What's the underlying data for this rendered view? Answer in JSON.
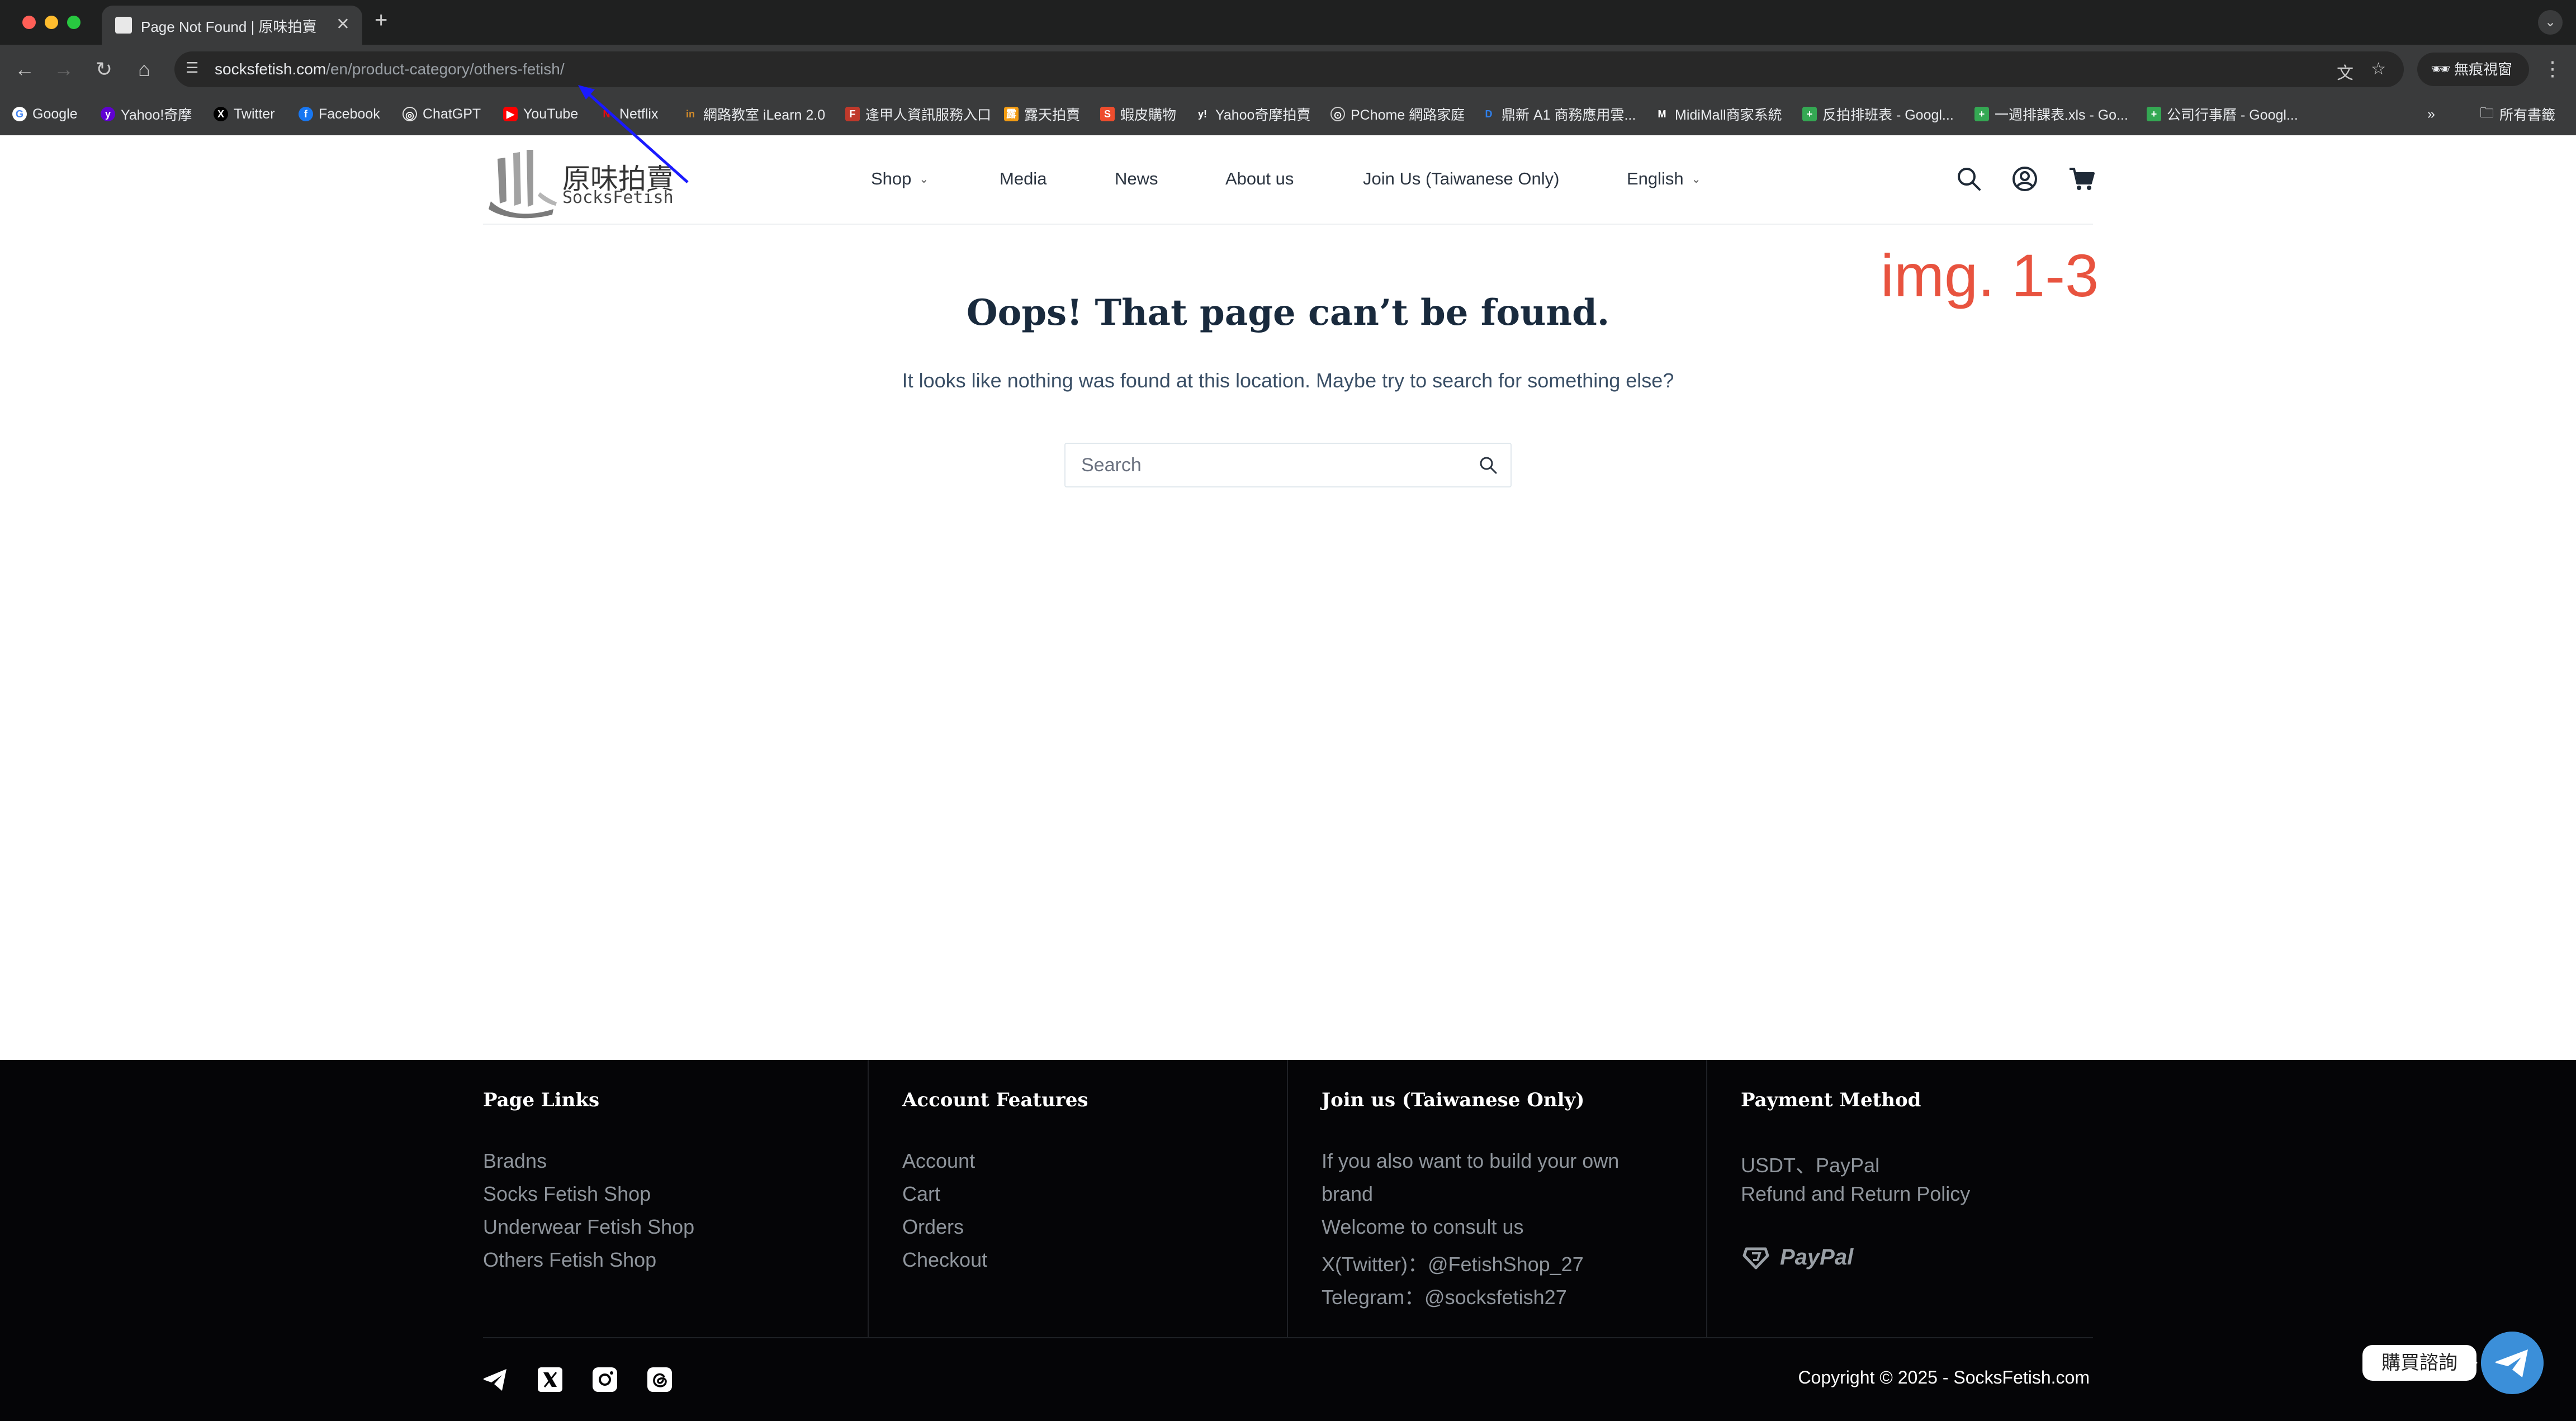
{
  "browser": {
    "tab_title": "Page Not Found | 原味拍賣",
    "url_host": "socksfetish.com",
    "url_path": "/en/product-category/others-fetish/",
    "incognito_label": "無痕視窗",
    "bookmarks": [
      {
        "label": "Google",
        "icon": "google-icon",
        "color": "#ffffff"
      },
      {
        "label": "Yahoo!奇摩",
        "icon": "yahoo-icon",
        "color": "#6001d2"
      },
      {
        "label": "Twitter",
        "icon": "x-icon",
        "color": "#000000"
      },
      {
        "label": "Facebook",
        "icon": "facebook-icon",
        "color": "#1877f2"
      },
      {
        "label": "ChatGPT",
        "icon": "chatgpt-icon",
        "color": "#ffffff"
      },
      {
        "label": "YouTube",
        "icon": "youtube-icon",
        "color": "#ff0000"
      },
      {
        "label": "Netflix",
        "icon": "netflix-icon",
        "color": "#e50914"
      },
      {
        "label": "網路教室 iLearn 2.0",
        "icon": "ilearn-icon",
        "color": "#d08a2a"
      },
      {
        "label": "逢甲人資訊服務入口",
        "icon": "fcu-icon",
        "color": "#c0392b"
      },
      {
        "label": "露天拍賣",
        "icon": "ruten-icon",
        "color": "#f39c12"
      },
      {
        "label": "蝦皮購物",
        "icon": "shopee-icon",
        "color": "#ee4d2d"
      },
      {
        "label": "Yahoo奇摩拍賣",
        "icon": "yahoo-auction-icon",
        "color": "#ffffff"
      },
      {
        "label": "PChome 網路家庭",
        "icon": "pchome-icon",
        "color": "#cccccc"
      },
      {
        "label": "鼎新 A1 商務應用雲...",
        "icon": "digiwin-icon",
        "color": "#2f80ed"
      },
      {
        "label": "MidiMall商家系統",
        "icon": "midimall-icon",
        "color": "#ffffff"
      },
      {
        "label": "反拍排班表 - Googl...",
        "icon": "sheets-icon",
        "color": "#34a853"
      },
      {
        "label": "一週排課表.xls - Go...",
        "icon": "sheets-icon",
        "color": "#34a853"
      },
      {
        "label": "公司行事曆 - Googl...",
        "icon": "sheets-icon",
        "color": "#34a853"
      }
    ],
    "all_bookmarks_label": "所有書籤"
  },
  "header": {
    "logo_cn": "原味拍賣",
    "logo_en": "SocksFetish",
    "nav": [
      {
        "label": "Shop",
        "dropdown": true
      },
      {
        "label": "Media",
        "dropdown": false
      },
      {
        "label": "News",
        "dropdown": false
      },
      {
        "label": "About us",
        "dropdown": false
      },
      {
        "label": "Join Us (Taiwanese Only)",
        "dropdown": false
      },
      {
        "label": "English",
        "dropdown": true
      }
    ]
  },
  "annotation": "img. 1-3",
  "main": {
    "title": "Oops! That page can’t be found.",
    "subtitle": "It looks like nothing was found at this location. Maybe try to search for something else?",
    "search_placeholder": "Search"
  },
  "footer": {
    "columns": [
      {
        "title": "Page Links",
        "links": [
          "Bradns",
          "Socks Fetish Shop",
          "Underwear Fetish Shop",
          "Others Fetish Shop"
        ]
      },
      {
        "title": "Account Features",
        "links": [
          "Account",
          "Cart",
          "Orders",
          "Checkout"
        ]
      },
      {
        "title": "Join us (Taiwanese Only)",
        "links": [
          "If you also want to build your own",
          "brand",
          "Welcome to consult us",
          "X(Twitter)：@FetishShop_27",
          "Telegram：@socksfetish27"
        ]
      },
      {
        "title": "Payment Method",
        "links": [
          "USDT、PayPal",
          "Refund and Return Policy"
        ],
        "paypal_label": "PayPal"
      }
    ],
    "copyright": "Copyright © 2025 - SocksFetish.com",
    "social_icons": [
      "telegram-icon",
      "x-icon",
      "instagram-icon",
      "threads-icon"
    ]
  },
  "chat": {
    "label": "購買諮詢"
  },
  "colors": {
    "annotation": "#e8533f",
    "footer_bg": "#050507",
    "chat_button": "#3b8fd9"
  }
}
